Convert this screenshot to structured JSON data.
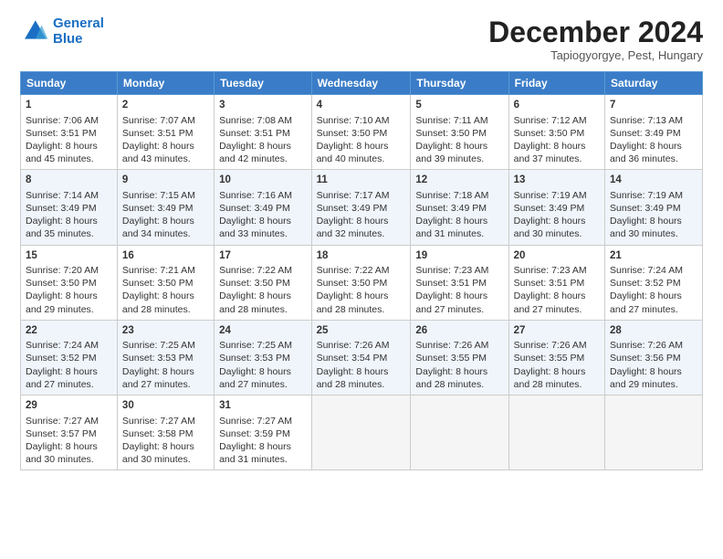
{
  "header": {
    "logo_line1": "General",
    "logo_line2": "Blue",
    "month": "December 2024",
    "location": "Tapiogyorgye, Pest, Hungary"
  },
  "days_of_week": [
    "Sunday",
    "Monday",
    "Tuesday",
    "Wednesday",
    "Thursday",
    "Friday",
    "Saturday"
  ],
  "weeks": [
    [
      {
        "day": "1",
        "lines": [
          "Sunrise: 7:06 AM",
          "Sunset: 3:51 PM",
          "Daylight: 8 hours",
          "and 45 minutes."
        ]
      },
      {
        "day": "2",
        "lines": [
          "Sunrise: 7:07 AM",
          "Sunset: 3:51 PM",
          "Daylight: 8 hours",
          "and 43 minutes."
        ]
      },
      {
        "day": "3",
        "lines": [
          "Sunrise: 7:08 AM",
          "Sunset: 3:51 PM",
          "Daylight: 8 hours",
          "and 42 minutes."
        ]
      },
      {
        "day": "4",
        "lines": [
          "Sunrise: 7:10 AM",
          "Sunset: 3:50 PM",
          "Daylight: 8 hours",
          "and 40 minutes."
        ]
      },
      {
        "day": "5",
        "lines": [
          "Sunrise: 7:11 AM",
          "Sunset: 3:50 PM",
          "Daylight: 8 hours",
          "and 39 minutes."
        ]
      },
      {
        "day": "6",
        "lines": [
          "Sunrise: 7:12 AM",
          "Sunset: 3:50 PM",
          "Daylight: 8 hours",
          "and 37 minutes."
        ]
      },
      {
        "day": "7",
        "lines": [
          "Sunrise: 7:13 AM",
          "Sunset: 3:49 PM",
          "Daylight: 8 hours",
          "and 36 minutes."
        ]
      }
    ],
    [
      {
        "day": "8",
        "lines": [
          "Sunrise: 7:14 AM",
          "Sunset: 3:49 PM",
          "Daylight: 8 hours",
          "and 35 minutes."
        ]
      },
      {
        "day": "9",
        "lines": [
          "Sunrise: 7:15 AM",
          "Sunset: 3:49 PM",
          "Daylight: 8 hours",
          "and 34 minutes."
        ]
      },
      {
        "day": "10",
        "lines": [
          "Sunrise: 7:16 AM",
          "Sunset: 3:49 PM",
          "Daylight: 8 hours",
          "and 33 minutes."
        ]
      },
      {
        "day": "11",
        "lines": [
          "Sunrise: 7:17 AM",
          "Sunset: 3:49 PM",
          "Daylight: 8 hours",
          "and 32 minutes."
        ]
      },
      {
        "day": "12",
        "lines": [
          "Sunrise: 7:18 AM",
          "Sunset: 3:49 PM",
          "Daylight: 8 hours",
          "and 31 minutes."
        ]
      },
      {
        "day": "13",
        "lines": [
          "Sunrise: 7:19 AM",
          "Sunset: 3:49 PM",
          "Daylight: 8 hours",
          "and 30 minutes."
        ]
      },
      {
        "day": "14",
        "lines": [
          "Sunrise: 7:19 AM",
          "Sunset: 3:49 PM",
          "Daylight: 8 hours",
          "and 30 minutes."
        ]
      }
    ],
    [
      {
        "day": "15",
        "lines": [
          "Sunrise: 7:20 AM",
          "Sunset: 3:50 PM",
          "Daylight: 8 hours",
          "and 29 minutes."
        ]
      },
      {
        "day": "16",
        "lines": [
          "Sunrise: 7:21 AM",
          "Sunset: 3:50 PM",
          "Daylight: 8 hours",
          "and 28 minutes."
        ]
      },
      {
        "day": "17",
        "lines": [
          "Sunrise: 7:22 AM",
          "Sunset: 3:50 PM",
          "Daylight: 8 hours",
          "and 28 minutes."
        ]
      },
      {
        "day": "18",
        "lines": [
          "Sunrise: 7:22 AM",
          "Sunset: 3:50 PM",
          "Daylight: 8 hours",
          "and 28 minutes."
        ]
      },
      {
        "day": "19",
        "lines": [
          "Sunrise: 7:23 AM",
          "Sunset: 3:51 PM",
          "Daylight: 8 hours",
          "and 27 minutes."
        ]
      },
      {
        "day": "20",
        "lines": [
          "Sunrise: 7:23 AM",
          "Sunset: 3:51 PM",
          "Daylight: 8 hours",
          "and 27 minutes."
        ]
      },
      {
        "day": "21",
        "lines": [
          "Sunrise: 7:24 AM",
          "Sunset: 3:52 PM",
          "Daylight: 8 hours",
          "and 27 minutes."
        ]
      }
    ],
    [
      {
        "day": "22",
        "lines": [
          "Sunrise: 7:24 AM",
          "Sunset: 3:52 PM",
          "Daylight: 8 hours",
          "and 27 minutes."
        ]
      },
      {
        "day": "23",
        "lines": [
          "Sunrise: 7:25 AM",
          "Sunset: 3:53 PM",
          "Daylight: 8 hours",
          "and 27 minutes."
        ]
      },
      {
        "day": "24",
        "lines": [
          "Sunrise: 7:25 AM",
          "Sunset: 3:53 PM",
          "Daylight: 8 hours",
          "and 27 minutes."
        ]
      },
      {
        "day": "25",
        "lines": [
          "Sunrise: 7:26 AM",
          "Sunset: 3:54 PM",
          "Daylight: 8 hours",
          "and 28 minutes."
        ]
      },
      {
        "day": "26",
        "lines": [
          "Sunrise: 7:26 AM",
          "Sunset: 3:55 PM",
          "Daylight: 8 hours",
          "and 28 minutes."
        ]
      },
      {
        "day": "27",
        "lines": [
          "Sunrise: 7:26 AM",
          "Sunset: 3:55 PM",
          "Daylight: 8 hours",
          "and 28 minutes."
        ]
      },
      {
        "day": "28",
        "lines": [
          "Sunrise: 7:26 AM",
          "Sunset: 3:56 PM",
          "Daylight: 8 hours",
          "and 29 minutes."
        ]
      }
    ],
    [
      {
        "day": "29",
        "lines": [
          "Sunrise: 7:27 AM",
          "Sunset: 3:57 PM",
          "Daylight: 8 hours",
          "and 30 minutes."
        ]
      },
      {
        "day": "30",
        "lines": [
          "Sunrise: 7:27 AM",
          "Sunset: 3:58 PM",
          "Daylight: 8 hours",
          "and 30 minutes."
        ]
      },
      {
        "day": "31",
        "lines": [
          "Sunrise: 7:27 AM",
          "Sunset: 3:59 PM",
          "Daylight: 8 hours",
          "and 31 minutes."
        ]
      },
      null,
      null,
      null,
      null
    ]
  ]
}
